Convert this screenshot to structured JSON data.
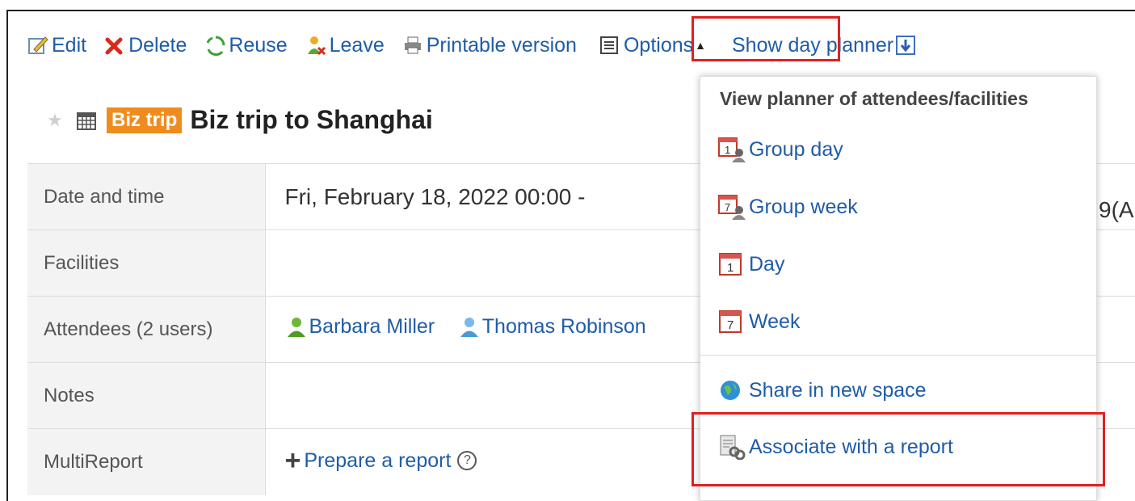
{
  "toolbar": {
    "edit": "Edit",
    "delete": "Delete",
    "reuse": "Reuse",
    "leave": "Leave",
    "printable": "Printable version",
    "options": "Options",
    "show_day_planner": "Show day planner"
  },
  "event": {
    "badge": "Biz trip",
    "title": "Biz trip to Shanghai"
  },
  "details": {
    "date_label": "Date and time",
    "date_value": "Fri, February 18, 2022   00:00   -",
    "date_tail": "9(A",
    "facilities_label": "Facilities",
    "attendees_label": "Attendees (2 users)",
    "attendees": [
      "Barbara Miller",
      "Thomas Robinson"
    ],
    "notes_label": "Notes",
    "multireport_label": "MultiReport",
    "prepare_report": "Prepare a report"
  },
  "dropdown": {
    "header": "View planner of attendees/facilities",
    "items": [
      "Group day",
      "Group week",
      "Day",
      "Week"
    ],
    "share": "Share in new space",
    "associate": "Associate with a report"
  },
  "colors": {
    "link": "#1f5ca8",
    "badge": "#f08c1e",
    "highlight": "#e02020"
  }
}
